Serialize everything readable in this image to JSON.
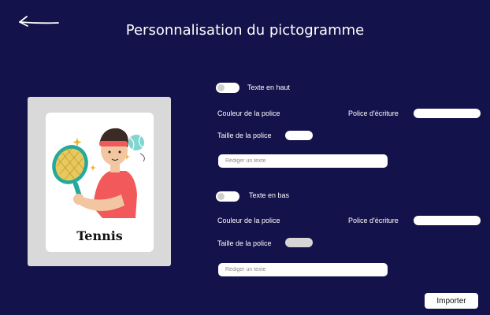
{
  "header": {
    "title": "Personnalisation du pictogramme",
    "back_icon": "arrow-left-icon"
  },
  "preview": {
    "label": "Tennis",
    "illustration_icon": "tennis-player-icon"
  },
  "top_text": {
    "toggle_label": "Texte en haut",
    "font_color_label": "Couleur de la police",
    "font_family_label": "Police d'écriture",
    "font_size_label": "Taille de la police",
    "text_placeholder": "Rédiger un texte"
  },
  "bottom_text": {
    "toggle_label": "Texte en bas",
    "font_color_label": "Couleur de la police",
    "font_family_label": "Police d'écriture",
    "font_size_label": "Taille de la police",
    "text_placeholder": "Rédiger un texte"
  },
  "actions": {
    "import_label": "Importer"
  },
  "colors": {
    "background": "#14124a",
    "preview_frame": "#d9d9d9",
    "card": "#ffffff"
  }
}
